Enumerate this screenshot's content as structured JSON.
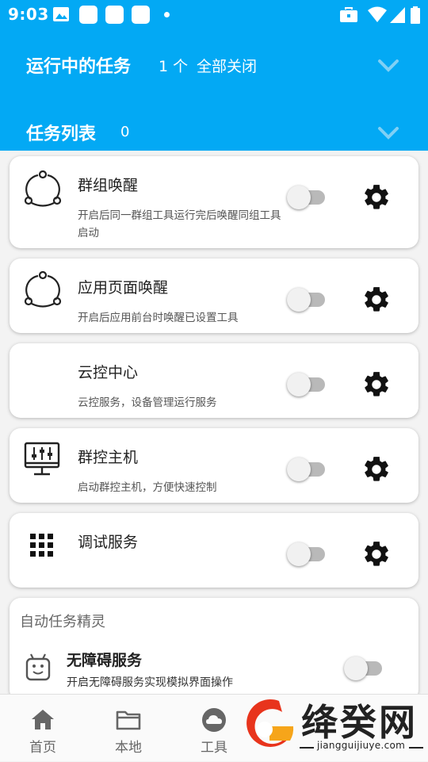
{
  "status_bar": {
    "time": "9:03"
  },
  "header": {
    "running": {
      "title": "运行中的任务",
      "count": "1 个",
      "close_all": "全部关闭"
    },
    "task_list": {
      "title": "任务列表",
      "count": "0"
    }
  },
  "tasks": [
    {
      "title": "群组唤醒",
      "desc": "开启后同一群组工具运行完后唤醒同组工具启动",
      "icon": "cycle-arrows-icon",
      "enabled": false
    },
    {
      "title": "应用页面唤醒",
      "desc": "开启后应用前台时唤醒已设置工具",
      "icon": "cycle-arrows-icon",
      "enabled": false
    },
    {
      "title": "云控中心",
      "desc": "云控服务，设备管理运行服务",
      "icon": "",
      "enabled": false
    },
    {
      "title": "群控主机",
      "desc": "启动群控主机，方便快速控制",
      "icon": "monitor-sliders-icon",
      "enabled": false
    },
    {
      "title": "调试服务",
      "desc": "",
      "icon": "grid-dots-icon",
      "enabled": false
    }
  ],
  "sprite_section": {
    "title": "自动任务精灵",
    "item": {
      "title": "无障碍服务",
      "desc": "开启无障碍服务实现模拟界面操作",
      "icon": "robot-icon",
      "enabled": false
    }
  },
  "bottom_nav": [
    {
      "label": "首页",
      "icon": "home-icon"
    },
    {
      "label": "本地",
      "icon": "folder-icon"
    },
    {
      "label": "工具",
      "icon": "cloud-icon"
    }
  ],
  "watermark": {
    "text": "绛癸网",
    "url": "jiangguijiuye.com"
  },
  "colors": {
    "accent": "#03a9f4",
    "watermark_red": "#e8341c",
    "watermark_orange": "#f6a51a"
  }
}
